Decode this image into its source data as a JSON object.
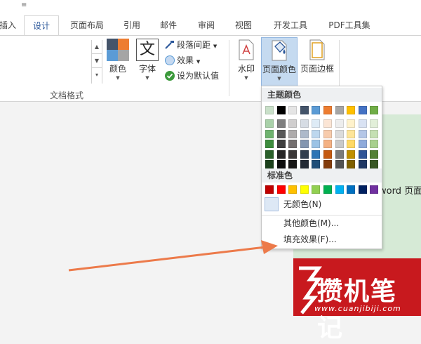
{
  "quick_access": {
    "mark": "≡"
  },
  "tabs": [
    {
      "label": "插入",
      "active": false
    },
    {
      "label": "设计",
      "active": true
    },
    {
      "label": "页面布局",
      "active": false
    },
    {
      "label": "引用",
      "active": false
    },
    {
      "label": "邮件",
      "active": false
    },
    {
      "label": "审阅",
      "active": false
    },
    {
      "label": "视图",
      "active": false
    },
    {
      "label": "开发工具",
      "active": false
    },
    {
      "label": "PDF工具集",
      "active": false
    }
  ],
  "ribbon": {
    "colors_label": "颜色",
    "fonts_label": "字体",
    "fonts_glyph": "文",
    "paragraph_spacing_label": "段落间距",
    "effects_label": "效果",
    "set_default_label": "设为默认值",
    "group_label": "文档格式",
    "watermark_label": "水印",
    "page_color_label": "页面颜色",
    "page_borders_label": "页面边框"
  },
  "menu": {
    "theme_colors_header": "主题颜色",
    "standard_colors_header": "标准色",
    "no_color_label": "无颜色(N)",
    "more_colors_label": "其他颜色(M)...",
    "fill_effects_label": "填充效果(F)...",
    "theme_top_row": [
      "#c9e0c9",
      "#000000",
      "#e5e5e5",
      "#44546a",
      "#5b9bd5",
      "#ed7d31",
      "#a5a5a5",
      "#ffc000",
      "#4472c4",
      "#70ad47"
    ],
    "theme_shades": [
      [
        "#a9d1a9",
        "#7f7f7f",
        "#d0cece",
        "#d6dce4",
        "#deebf6",
        "#fbe5d5",
        "#ededed",
        "#fff2cc",
        "#d9e2f3",
        "#e2efd9"
      ],
      [
        "#6fb36f",
        "#595959",
        "#aeabab",
        "#adb9ca",
        "#bdd7ee",
        "#f7cbac",
        "#dbdbdb",
        "#fee599",
        "#b4c6e7",
        "#c5e0b3"
      ],
      [
        "#3d8c3d",
        "#3f3f3f",
        "#757070",
        "#8496b0",
        "#9cc3e5",
        "#f4b183",
        "#c9c9c9",
        "#ffd965",
        "#8eaadb",
        "#a8d08d"
      ],
      [
        "#2a602a",
        "#262626",
        "#3a3838",
        "#323f4f",
        "#2e75b5",
        "#c55a11",
        "#7b7b7b",
        "#bf8f00",
        "#2f5496",
        "#538135"
      ],
      [
        "#1c411c",
        "#0d0d0d",
        "#171616",
        "#222a35",
        "#1e4e79",
        "#833c0b",
        "#525252",
        "#7f6000",
        "#1f3864",
        "#375623"
      ]
    ],
    "standard_row": [
      "#c00000",
      "#ff0000",
      "#ffc000",
      "#ffff00",
      "#92d050",
      "#00b050",
      "#00b0f0",
      "#0070c0",
      "#002060",
      "#7030a0"
    ]
  },
  "document": {
    "visible_text": "word 页面"
  },
  "watermark": {
    "brand": "攒机笔记",
    "url": "www.cuanjibiji.com"
  }
}
